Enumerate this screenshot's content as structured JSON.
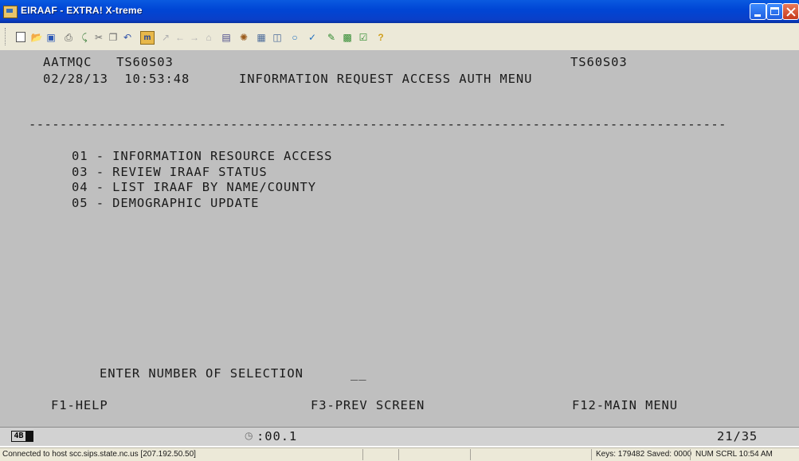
{
  "window": {
    "title": "EIRAAF - EXTRA! X-treme"
  },
  "toolbar": {
    "icons": [
      "new-icon",
      "open-icon",
      "save-icon",
      "print-icon",
      "transfer-icon",
      "cut-icon",
      "copy-icon",
      "undo-icon",
      "macro-icon",
      "link-icon",
      "back-icon",
      "forward-icon",
      "home-icon",
      "sessions-icon",
      "tools-icon",
      "copy-screen-icon",
      "print-screen-icon",
      "record-icon",
      "settings-icon",
      "edit-icon",
      "tile-icon",
      "session-icon",
      "help-icon"
    ]
  },
  "terminal": {
    "header_left": "AATMQC   TS60S03",
    "header_right": "TS60S03",
    "datetime": "02/28/13  10:53:48",
    "menu_title": "INFORMATION REQUEST ACCESS AUTH MENU",
    "separator": "------------------------------------------------------------------------------------------",
    "options": [
      "01 - INFORMATION RESOURCE ACCESS",
      "03 - REVIEW IRAAF STATUS",
      "04 - LIST IRAAF BY NAME/COUNTY",
      "05 - DEMOGRAPHIC UPDATE"
    ],
    "prompt": "ENTER NUMBER OF SELECTION",
    "input_value": "__",
    "fkeys": {
      "f1": "F1-HELP",
      "f3": "F3-PREV SCREEN",
      "f12": "F12-MAIN MENU"
    }
  },
  "oia": {
    "session_indicator": "4B",
    "timer": ":00.1",
    "cursor_position": "21/35"
  },
  "statusbar": {
    "connection": "Connected to host scc.sips.state.nc.us [207.192.50.50]",
    "keys_saved": "Keys: 179482  Saved: 0000",
    "indicators": "NUM  SCRL  10:54 AM"
  }
}
